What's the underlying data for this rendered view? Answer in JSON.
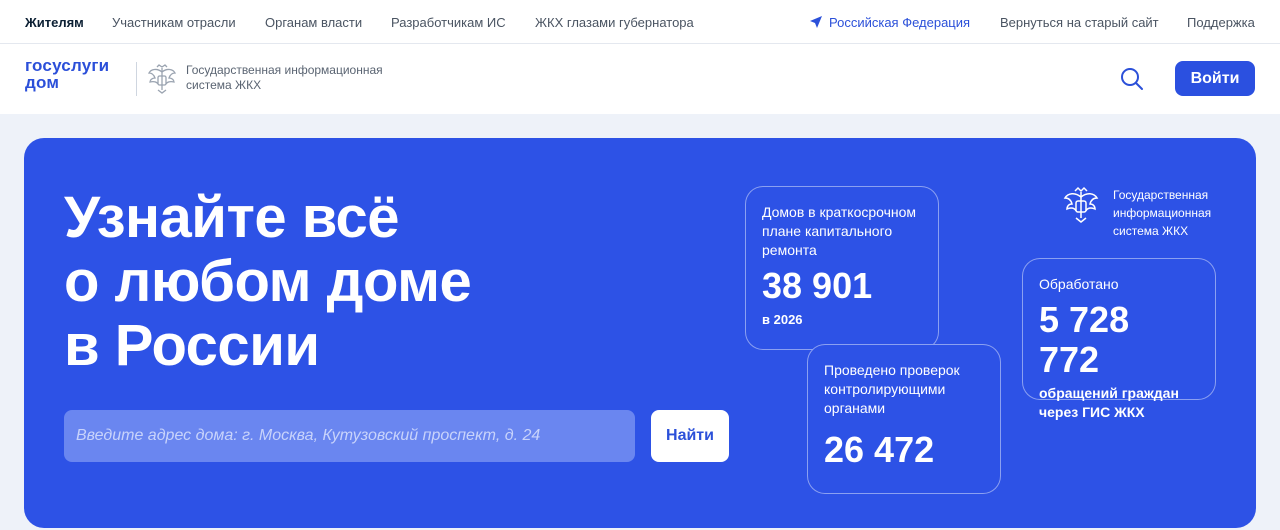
{
  "topnav": {
    "items": [
      {
        "label": "Жителям",
        "active": true
      },
      {
        "label": "Участникам отрасли"
      },
      {
        "label": "Органам власти"
      },
      {
        "label": "Разработчикам ИС"
      },
      {
        "label": "ЖКХ глазами губернатора"
      }
    ],
    "region": "Российская Федерация",
    "old_site": "Вернуться на старый сайт",
    "support": "Поддержка",
    "region_icon": "location-arrow-icon"
  },
  "header": {
    "logo_line1": "госуслуги",
    "logo_line2": "дом",
    "system_title": "Государственная информационная система ЖКХ",
    "search_icon": "search-icon",
    "login_label": "Войти",
    "emblem_icon": "eagle-emblem-icon"
  },
  "hero": {
    "title_lines": [
      "Узнайте всё",
      "о любом доме",
      "в России"
    ],
    "search_placeholder": "Введите адрес дома: г. Москва, Кутузовский проспект, д. 24",
    "find_label": "Найти",
    "badge_text": "Государственная информационная система ЖКХ",
    "cards": [
      {
        "label": "Домов в краткосрочном плане капитального ремонта",
        "value": "38 901",
        "note": "в 2026"
      },
      {
        "label": "Проведено проверок контролирующими органами",
        "value": "26 472"
      },
      {
        "label": "Обработано",
        "value": "5 728 772",
        "desc": "обращений граждан через ГИС ЖКХ"
      }
    ]
  },
  "colors": {
    "accent": "#2b50e0",
    "hero_bg": "#2d52e6",
    "page_bg": "#eef2f9"
  }
}
